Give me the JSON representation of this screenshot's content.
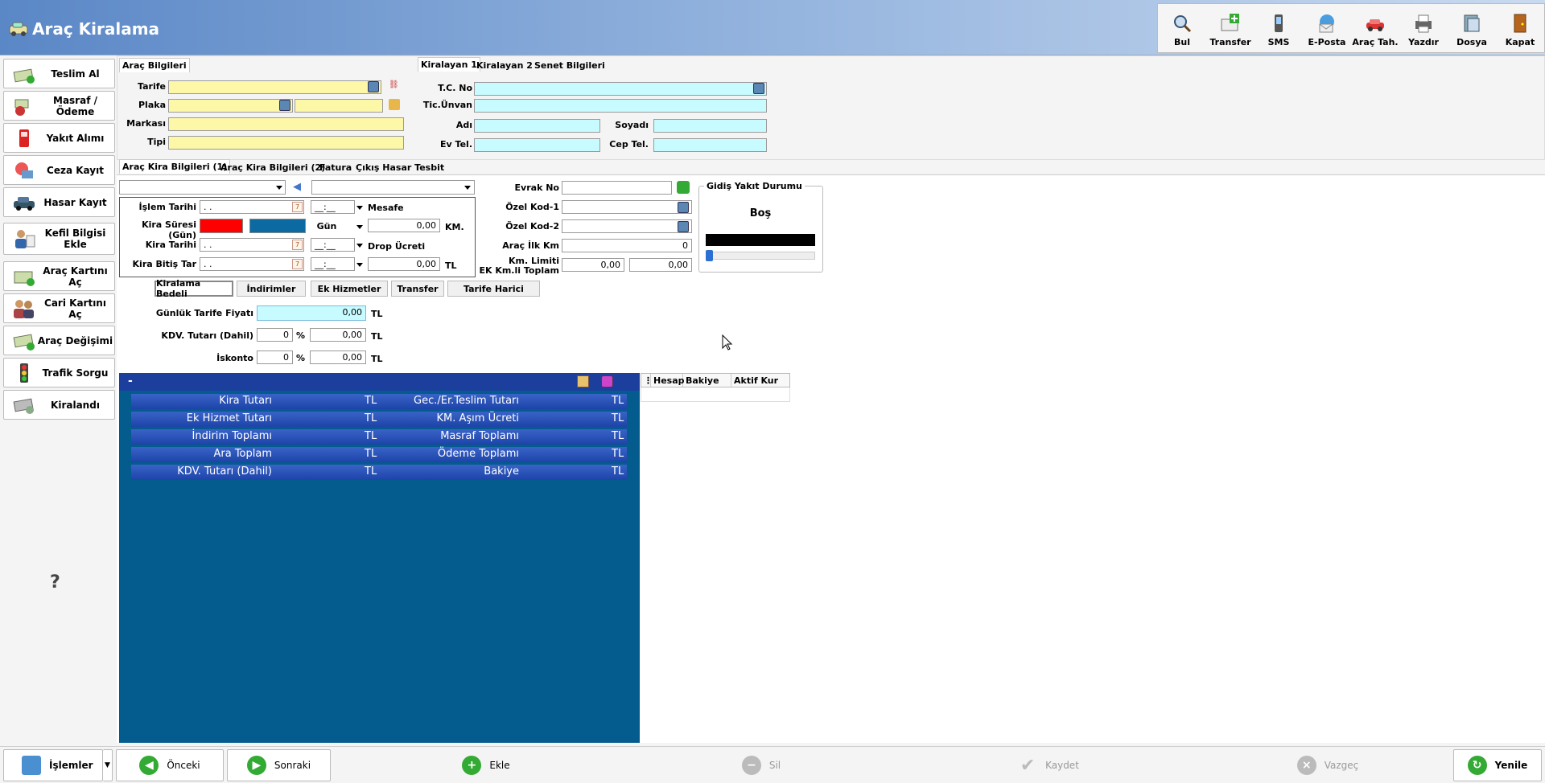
{
  "window": {
    "title": "Araç Kiralama"
  },
  "toolbar": [
    {
      "label": "Bul",
      "icon": "search-icon"
    },
    {
      "label": "Transfer",
      "icon": "transfer-icon"
    },
    {
      "label": "SMS",
      "icon": "phone-icon"
    },
    {
      "label": "E-Posta",
      "icon": "email-icon"
    },
    {
      "label": "Araç Tah.",
      "icon": "car-icon"
    },
    {
      "label": "Yazdır",
      "icon": "printer-icon"
    },
    {
      "label": "Dosya",
      "icon": "folder-icon"
    },
    {
      "label": "Kapat",
      "icon": "door-exit-icon"
    }
  ],
  "sidebar": [
    {
      "label": "Teslim Al",
      "icon": "money-car-icon"
    },
    {
      "label": "Masraf / Ödeme",
      "icon": "expense-icon"
    },
    {
      "label": "Yakıt Alımı",
      "icon": "fuel-pump-icon"
    },
    {
      "label": "Ceza Kayıt",
      "icon": "penalty-icon"
    },
    {
      "label": "Hasar Kayıt",
      "icon": "damaged-car-icon"
    },
    {
      "label": "Kefil Bilgisi Ekle",
      "icon": "guarantor-icon"
    },
    {
      "label": "Araç Kartını Aç",
      "icon": "car-card-icon"
    },
    {
      "label": "Cari Kartını Aç",
      "icon": "people-icon"
    },
    {
      "label": "Araç Değişimi",
      "icon": "car-swap-icon"
    },
    {
      "label": "Trafik Sorgu",
      "icon": "traffic-light-icon"
    },
    {
      "label": "Kiralandı",
      "icon": "rented-icon"
    }
  ],
  "help": "?",
  "arac": {
    "tab": "Araç Bilgileri",
    "tarife": "Tarife",
    "plaka": "Plaka",
    "markasi": "Markası",
    "tipi": "Tipi"
  },
  "kiralayan": {
    "tabs": [
      "Kiralayan 1",
      "Kiralayan 2",
      "Senet Bilgileri"
    ],
    "tcno": "T.C. No",
    "ticunvan": "Tic.Ünvan",
    "adi": "Adı",
    "soyadi": "Soyadı",
    "evtel": "Ev Tel.",
    "ceptel": "Cep Tel."
  },
  "kiratabs": [
    "Araç Kira Bilgileri (1)",
    "Araç Kira Bilgileri (2)",
    "Fatura",
    "Çıkış Hasar Tesbit"
  ],
  "kira": {
    "islem_tarihi": "İşlem Tarihi",
    "islem_tarihi_val": ". .",
    "islem_saat": "__:__",
    "kira_suresi": "Kira Süresi (Gün)",
    "kira_tarihi": "Kira Tarihi",
    "kira_tarihi_val": ". .",
    "kira_saat": "__:__",
    "bitis": "Kira Bitiş Tar",
    "bitis_val": ". .",
    "bitis_saat": "__:__",
    "mesafe": "Mesafe",
    "gun": "Gün",
    "km_val": "0,00",
    "km": "KM.",
    "drop": "Drop Ücreti",
    "drop_val": "0,00",
    "tl": "TL"
  },
  "evrak": {
    "evrak_no": "Evrak No",
    "ozel1": "Özel Kod-1",
    "ozel2": "Özel Kod-2",
    "ilk_km": "Araç İlk Km",
    "ilk_km_val": "0",
    "km_limit": "Km. Limiti",
    "ek_km": "EK Km.li Toplam",
    "km_limit_val": "0,00",
    "ek_km_val": "0,00"
  },
  "yakit": {
    "title": "Gidiş Yakıt Durumu",
    "status": "Boş",
    "level": 0
  },
  "subtabs": [
    "Kiralama Bedeli",
    "İndirimler",
    "Ek Hizmetler",
    "Transfer",
    "Tarife Harici"
  ],
  "bedel": {
    "gunluk": "Günlük Tarife Fiyatı",
    "gunluk_val": "0,00",
    "kdv": "KDV. Tutarı (Dahil)",
    "kdv_pct": "0",
    "kdv_val": "0,00",
    "iskonto": "İskonto",
    "isk_pct": "0",
    "isk_val": "0,00",
    "pct": "%",
    "tl": "TL"
  },
  "summary": {
    "collapse": "-",
    "rows": [
      {
        "left": "Kira Tutarı",
        "lcur": "TL",
        "right": "Gec./Er.Teslim Tutarı",
        "rcur": "TL"
      },
      {
        "left": "Ek Hizmet Tutarı",
        "lcur": "TL",
        "right": "KM. Aşım Ücreti",
        "rcur": "TL"
      },
      {
        "left": "İndirim Toplamı",
        "lcur": "TL",
        "right": "Masraf Toplamı",
        "rcur": "TL"
      },
      {
        "left": "Ara Toplam",
        "lcur": "TL",
        "right": "Ödeme Toplamı",
        "rcur": "TL"
      },
      {
        "left": "KDV. Tutarı (Dahil)",
        "lcur": "TL",
        "right": "Bakiye",
        "rcur": "TL"
      }
    ]
  },
  "grid": {
    "columns": [
      "Hesap",
      "Bakiye",
      "Aktif Kur"
    ]
  },
  "bottom": {
    "islemler": "İşlemler",
    "onceki": "Önceki",
    "sonraki": "Sonraki",
    "ekle": "Ekle",
    "sil": "Sil",
    "kaydet": "Kaydet",
    "vazgec": "Vazgeç",
    "yenile": "Yenile"
  }
}
